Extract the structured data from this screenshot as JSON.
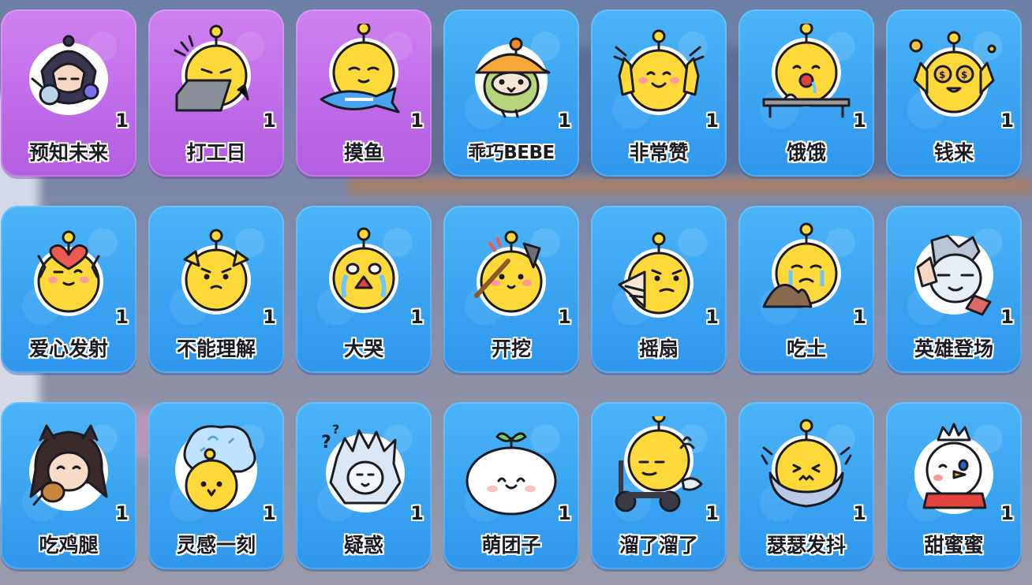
{
  "colors": {
    "card_blue": "#3aa4f2",
    "card_purple": "#bd6ae8",
    "mascot_yellow": "#ffd93a",
    "outline": "#1b1b24"
  },
  "stickers": [
    {
      "label": "预知未来",
      "count": "1",
      "bg": "purple",
      "icon": "dark-character-with-magnifier-icon"
    },
    {
      "label": "打工日",
      "count": "1",
      "bg": "purple",
      "icon": "mascot-typing-laptop-icon"
    },
    {
      "label": "摸鱼",
      "count": "1",
      "bg": "purple",
      "icon": "mascot-holding-fish-icon"
    },
    {
      "label": "乖巧BEBE",
      "count": "1",
      "bg": "blue",
      "icon": "green-bird-orange-hat-icon"
    },
    {
      "label": "非常赞",
      "count": "1",
      "bg": "blue",
      "icon": "mascot-thumbs-up-icon"
    },
    {
      "label": "饿饿",
      "count": "1",
      "bg": "blue",
      "icon": "mascot-hungry-table-icon"
    },
    {
      "label": "钱来",
      "count": "1",
      "bg": "blue",
      "icon": "mascot-money-eyes-icon"
    },
    {
      "label": "爱心发射",
      "count": "1",
      "bg": "blue",
      "icon": "mascot-heart-wink-icon"
    },
    {
      "label": "不能理解",
      "count": "1",
      "bg": "blue",
      "icon": "mascot-confused-icon"
    },
    {
      "label": "大哭",
      "count": "1",
      "bg": "blue",
      "icon": "mascot-crying-icon"
    },
    {
      "label": "开挖",
      "count": "1",
      "bg": "blue",
      "icon": "mascot-digging-icon"
    },
    {
      "label": "摇扇",
      "count": "1",
      "bg": "blue",
      "icon": "mascot-folding-fan-icon"
    },
    {
      "label": "吃土",
      "count": "1",
      "bg": "blue",
      "icon": "mascot-eating-dirt-icon"
    },
    {
      "label": "英雄登场",
      "count": "1",
      "bg": "blue",
      "icon": "hero-character-pose-icon"
    },
    {
      "label": "吃鸡腿",
      "count": "1",
      "bg": "blue",
      "icon": "girl-eating-drumstick-icon"
    },
    {
      "label": "灵感一刻",
      "count": "1",
      "bg": "blue",
      "icon": "mascot-inspiration-bubble-icon"
    },
    {
      "label": "疑惑",
      "count": "1",
      "bg": "blue",
      "icon": "ice-character-puzzled-icon"
    },
    {
      "label": "萌团子",
      "count": "1",
      "bg": "blue",
      "icon": "white-dumpling-sprout-icon"
    },
    {
      "label": "溜了溜了",
      "count": "1",
      "bg": "blue",
      "icon": "mascot-scooter-icon"
    },
    {
      "label": "瑟瑟发抖",
      "count": "1",
      "bg": "blue",
      "icon": "mascot-shivering-blanket-icon"
    },
    {
      "label": "甜蜜蜜",
      "count": "1",
      "bg": "blue",
      "icon": "snowman-king-wink-icon"
    }
  ]
}
